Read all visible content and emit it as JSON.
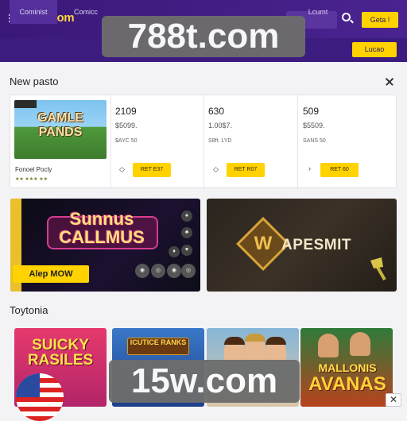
{
  "header": {
    "logo": "788t.com",
    "login_label": "Geta !"
  },
  "nav": {
    "tabs": [
      "Cominist",
      "Comicc"
    ],
    "cta_label": "Lucao",
    "right_label": "Lcumt"
  },
  "watermarks": {
    "top": "788t.com",
    "bottom": "15w.com"
  },
  "new_posts": {
    "title": "New pasto",
    "featured": {
      "thumb_text": "GAMLE PANDS",
      "name": "Fonoel Pocly",
      "rating": "★★ ★★★  ★★"
    },
    "offers": [
      {
        "big": "2109",
        "sub": "$5099.",
        "small": "$AYC 50",
        "icon": "◇",
        "button": "RET E37"
      },
      {
        "big": "630",
        "sub": "1.00$7.",
        "small": "S8ft. LYD",
        "icon": "◇",
        "button": "RET R07"
      },
      {
        "big": "509",
        "sub": "$5509.",
        "small": "SANS 50",
        "icon": "›",
        "button": "RET 60"
      }
    ]
  },
  "banners": {
    "left": {
      "title_line1": "Sunnus",
      "title_line2": "CALLMUS",
      "cta": "Alep MOW",
      "chips": [
        "♠",
        "♣",
        "♥",
        "♦",
        "◉",
        "◎",
        "◉",
        "◎"
      ]
    },
    "right": {
      "badge_letter": "W",
      "title": "APESMIT"
    }
  },
  "toptonia": {
    "title": "Toytonia",
    "games": [
      {
        "text": "SUICKY RASILES"
      },
      {
        "text": "ICUTICE RANKS"
      },
      {
        "text": ""
      },
      {
        "text_line1": "MALLONIS",
        "text_line2": "AVANAS"
      }
    ]
  },
  "colors": {
    "topbar": "#3a1878",
    "navbar": "#3c1c7e",
    "accent_yellow": "#ffd200",
    "logo_yellow": "#ffd23c"
  },
  "icons": [
    "menu-icon",
    "search-icon",
    "close-icon",
    "diamond-icon",
    "chevron-right-icon",
    "axe-icon",
    "ad-close-icon"
  ]
}
